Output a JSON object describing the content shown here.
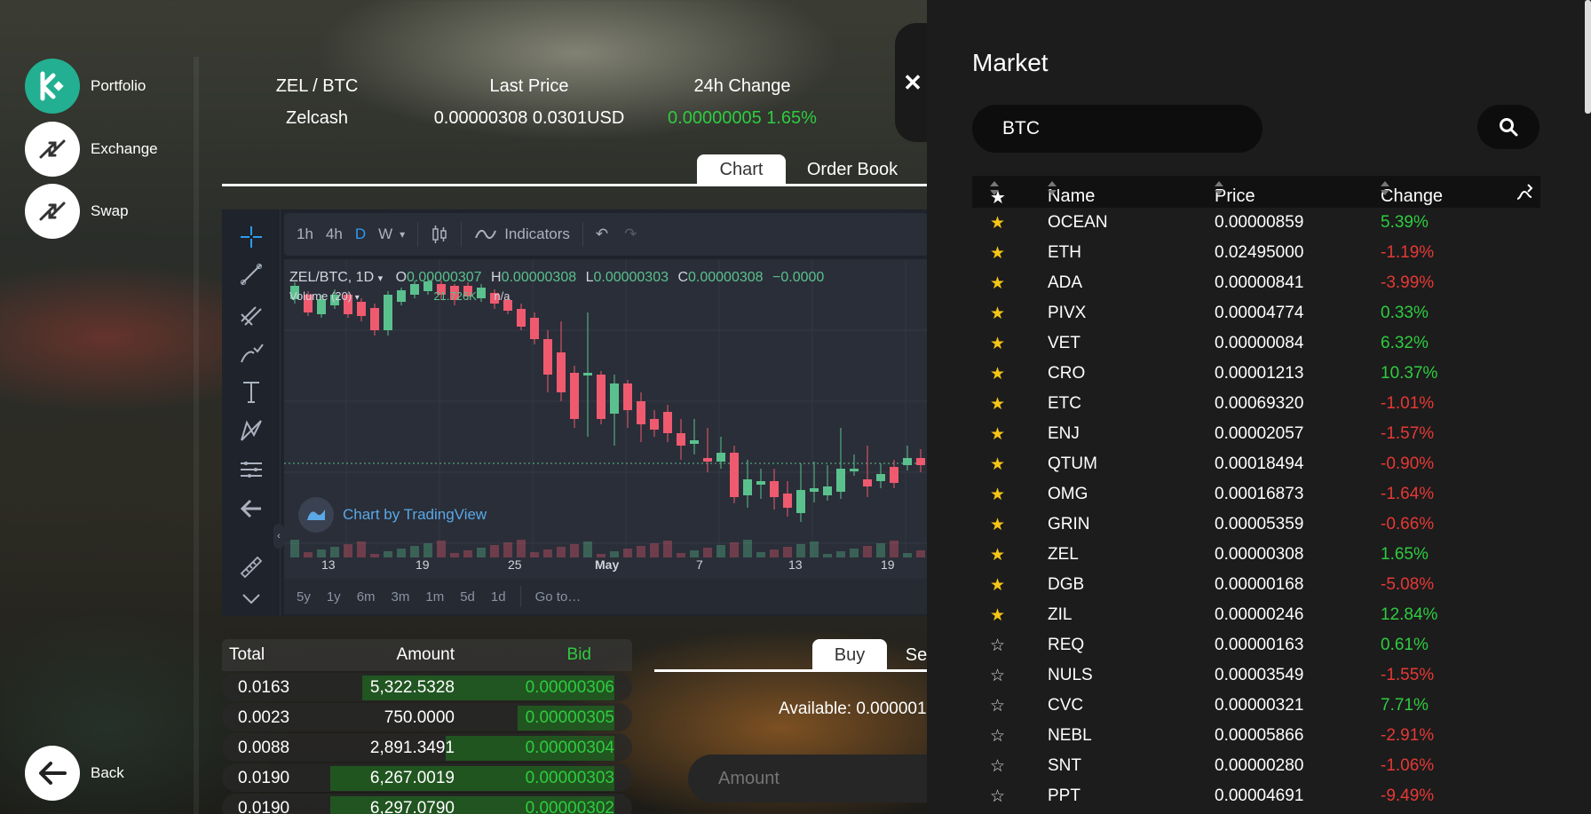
{
  "nav": {
    "portfolio": "Portfolio",
    "exchange": "Exchange",
    "swap": "Swap",
    "back": "Back"
  },
  "header": {
    "pair": "ZEL / BTC",
    "coin_name": "Zelcash",
    "last_price_label": "Last Price",
    "last_price_value": "0.00000308 0.0301USD",
    "change_label": "24h Change",
    "change_value": "0.00000005 1.65%"
  },
  "tabs": {
    "chart": "Chart",
    "order_book": "Order Book"
  },
  "chart": {
    "intervals": [
      "1h",
      "4h",
      "D",
      "W"
    ],
    "active_interval": "D",
    "indicators": "Indicators",
    "symbol": "ZEL/BTC, 1D",
    "ohlc": {
      "o_label": "O",
      "o": "0.00000307",
      "h_label": "H",
      "h": "0.00000308",
      "l_label": "L",
      "l": "0.00000303",
      "c_label": "C",
      "c": "0.00000308",
      "chg": "−0.0000"
    },
    "volume_label": "Volume (20)",
    "volume_value": "21.726K",
    "volume_na": "n/a",
    "watermark": "Chart by TradingView",
    "x_ticks": [
      "13",
      "19",
      "25",
      "May",
      "7",
      "13",
      "19"
    ],
    "ranges": [
      "5y",
      "1y",
      "6m",
      "3m",
      "1m",
      "5d",
      "1d"
    ],
    "goto": "Go to…",
    "colors": {
      "up": "#5ac18e",
      "down": "#ef5a6f"
    }
  },
  "order_book": {
    "headers": {
      "total": "Total",
      "amount": "Amount",
      "bid": "Bid"
    },
    "rows": [
      {
        "total": "0.0163",
        "amount": "5,322.5328",
        "bid": "0.00000306",
        "depth": 0.85
      },
      {
        "total": "0.0023",
        "amount": "750.0000",
        "bid": "0.00000305",
        "depth": 0.12
      },
      {
        "total": "0.0088",
        "amount": "2,891.3491",
        "bid": "0.00000304",
        "depth": 0.46
      },
      {
        "total": "0.0190",
        "amount": "6,267.0019",
        "bid": "0.00000303",
        "depth": 1.0
      },
      {
        "total": "0.0190",
        "amount": "6,297.0790",
        "bid": "0.00000302",
        "depth": 1.0
      }
    ]
  },
  "trade": {
    "buy": "Buy",
    "sell": "Se",
    "available": "Available: 0.000001",
    "amount_placeholder": "Amount"
  },
  "market": {
    "title": "Market",
    "search_value": "BTC",
    "headers": {
      "name": "Name",
      "price": "Price",
      "change": "Change"
    },
    "rows": [
      {
        "fav": true,
        "name": "OCEAN",
        "price": "0.00000859",
        "change": "5.39%",
        "up": true
      },
      {
        "fav": true,
        "name": "ETH",
        "price": "0.02495000",
        "change": "-1.19%",
        "up": false
      },
      {
        "fav": true,
        "name": "ADA",
        "price": "0.00000841",
        "change": "-3.99%",
        "up": false
      },
      {
        "fav": true,
        "name": "PIVX",
        "price": "0.00004774",
        "change": "0.33%",
        "up": true
      },
      {
        "fav": true,
        "name": "VET",
        "price": "0.00000084",
        "change": "6.32%",
        "up": true
      },
      {
        "fav": true,
        "name": "CRO",
        "price": "0.00001213",
        "change": "10.37%",
        "up": true
      },
      {
        "fav": true,
        "name": "ETC",
        "price": "0.00069320",
        "change": "-1.01%",
        "up": false
      },
      {
        "fav": true,
        "name": "ENJ",
        "price": "0.00002057",
        "change": "-1.57%",
        "up": false
      },
      {
        "fav": true,
        "name": "QTUM",
        "price": "0.00018494",
        "change": "-0.90%",
        "up": false
      },
      {
        "fav": true,
        "name": "OMG",
        "price": "0.00016873",
        "change": "-1.64%",
        "up": false
      },
      {
        "fav": true,
        "name": "GRIN",
        "price": "0.00005359",
        "change": "-0.66%",
        "up": false
      },
      {
        "fav": true,
        "name": "ZEL",
        "price": "0.00000308",
        "change": "1.65%",
        "up": true
      },
      {
        "fav": true,
        "name": "DGB",
        "price": "0.00000168",
        "change": "-5.08%",
        "up": false
      },
      {
        "fav": true,
        "name": "ZIL",
        "price": "0.00000246",
        "change": "12.84%",
        "up": true
      },
      {
        "fav": false,
        "name": "REQ",
        "price": "0.00000163",
        "change": "0.61%",
        "up": true
      },
      {
        "fav": false,
        "name": "NULS",
        "price": "0.00003549",
        "change": "-1.55%",
        "up": false
      },
      {
        "fav": false,
        "name": "CVC",
        "price": "0.00000321",
        "change": "7.71%",
        "up": true
      },
      {
        "fav": false,
        "name": "NEBL",
        "price": "0.00005866",
        "change": "-2.91%",
        "up": false
      },
      {
        "fav": false,
        "name": "SNT",
        "price": "0.00000280",
        "change": "-1.06%",
        "up": false
      },
      {
        "fav": false,
        "name": "PPT",
        "price": "0.00004691",
        "change": "-9.49%",
        "up": false
      }
    ]
  }
}
